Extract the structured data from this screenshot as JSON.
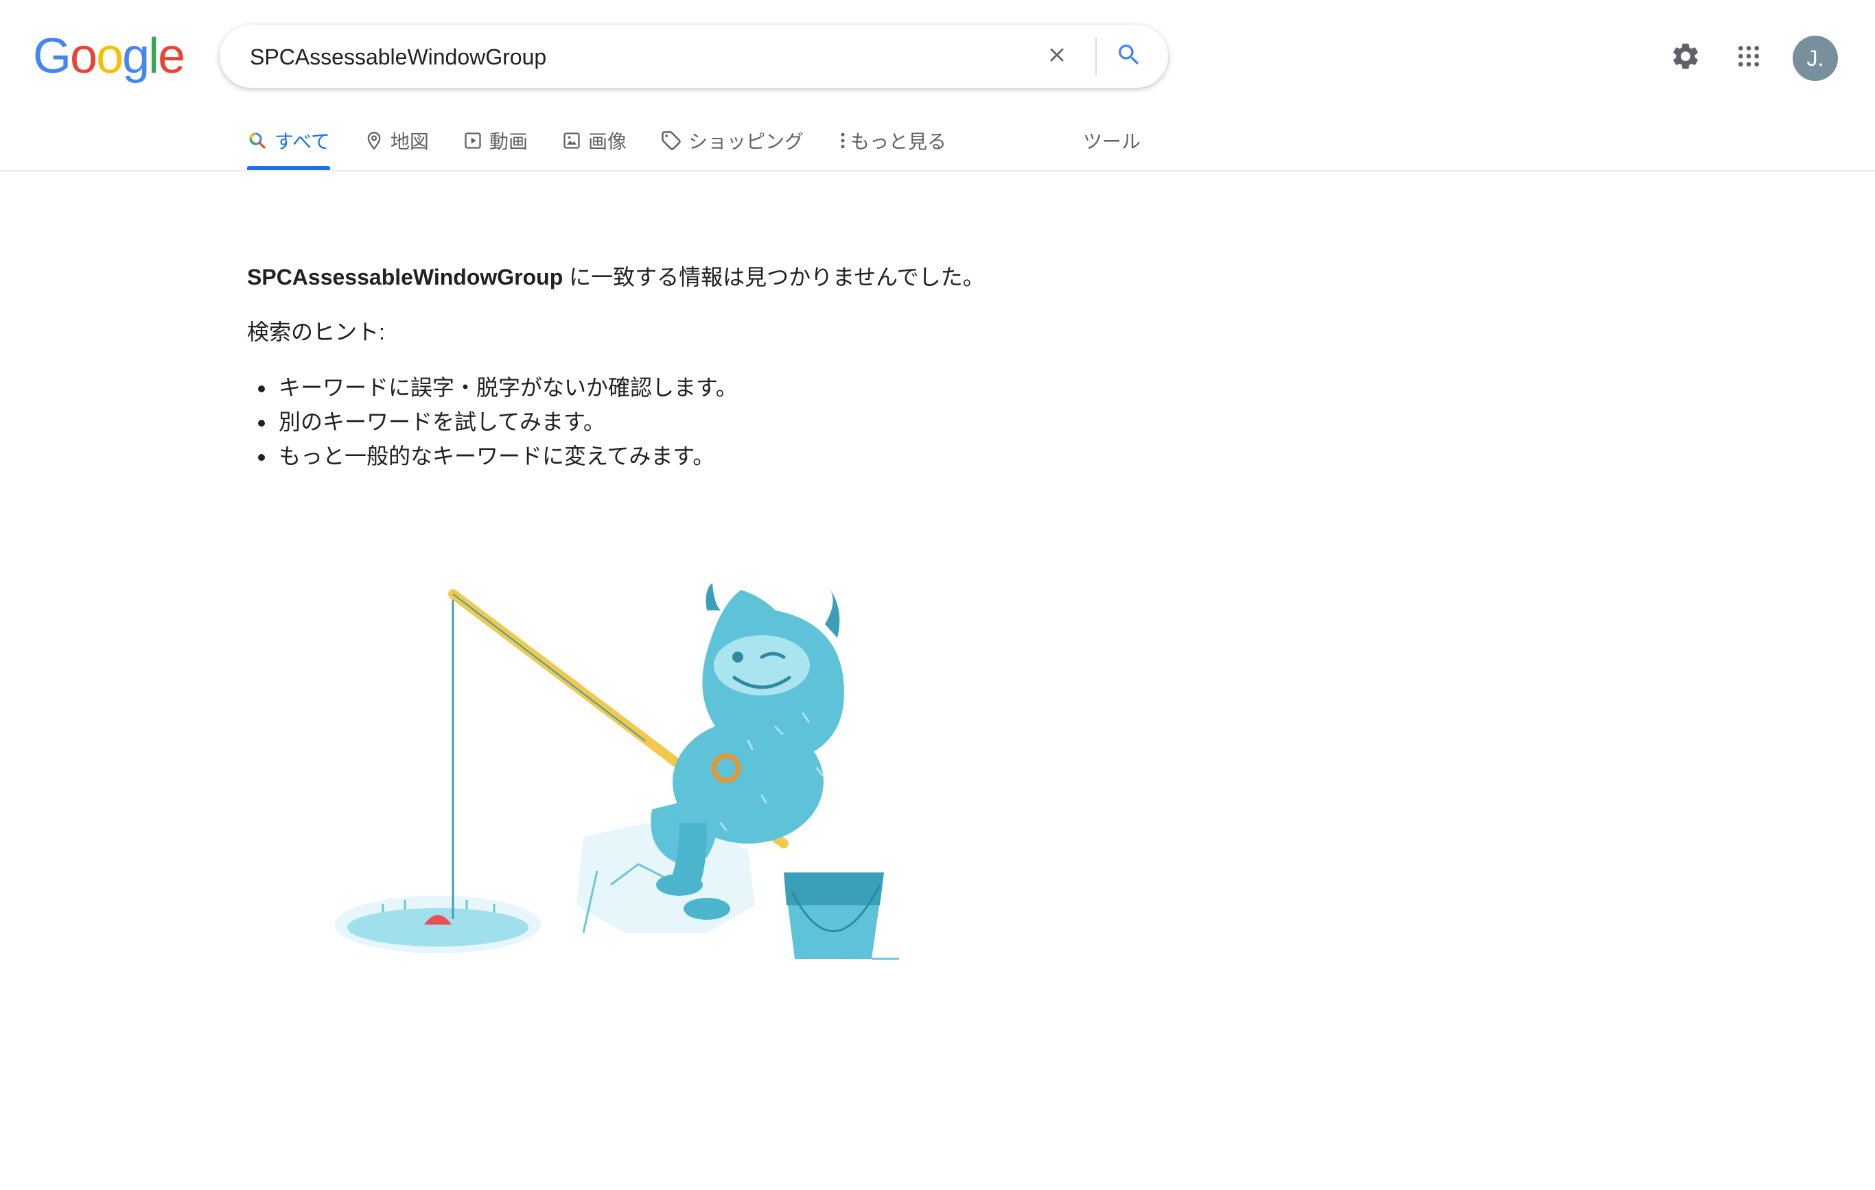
{
  "header": {
    "logo_text": "Google",
    "logo_letters": [
      {
        "ch": "G",
        "color": "#4285F4"
      },
      {
        "ch": "o",
        "color": "#EA4335"
      },
      {
        "ch": "o",
        "color": "#FBBC05"
      },
      {
        "ch": "g",
        "color": "#4285F4"
      },
      {
        "ch": "l",
        "color": "#34A853"
      },
      {
        "ch": "e",
        "color": "#EA4335"
      }
    ],
    "search": {
      "value": "SPCAssessableWindowGroup",
      "clear_icon": "close-icon",
      "search_icon": "search-icon"
    },
    "settings_icon": "gear-icon",
    "apps_icon": "apps-grid-icon",
    "avatar_initial": "J."
  },
  "tabs": [
    {
      "label": "すべて",
      "icon": "search-icon",
      "active": true
    },
    {
      "label": "地図",
      "icon": "map-pin-icon",
      "active": false
    },
    {
      "label": "動画",
      "icon": "video-icon",
      "active": false
    },
    {
      "label": "画像",
      "icon": "image-icon",
      "active": false
    },
    {
      "label": "ショッピング",
      "icon": "tag-icon",
      "active": false
    },
    {
      "label": "もっと見る",
      "icon": "more-vert-icon",
      "active": false
    }
  ],
  "tools_label": "ツール",
  "results": {
    "query_bold": "SPCAssessableWindowGroup",
    "no_match_suffix": " に一致する情報は見つかりませんでした。",
    "tips_title": "検索のヒント:",
    "tips": [
      "キーワードに誤字・脱字がないか確認します。",
      "別のキーワードを試してみます。",
      "もっと一般的なキーワードに変えてみます。"
    ]
  },
  "colors": {
    "accent": "#1a73e8",
    "text": "#202124",
    "muted": "#5f6368",
    "avatar_bg": "#78909c",
    "yeti": "#5ec3d8"
  }
}
